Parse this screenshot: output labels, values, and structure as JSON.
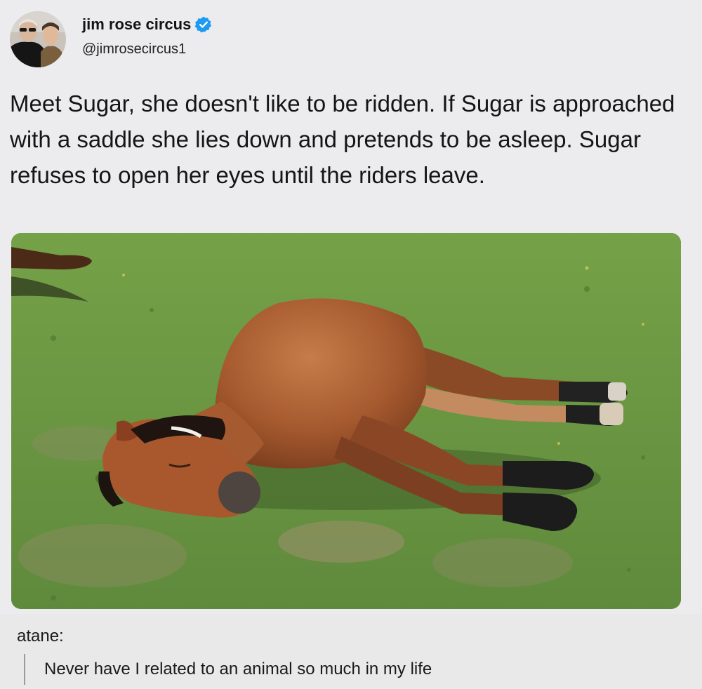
{
  "tweet": {
    "author_name": "jim rose circus",
    "author_handle": "@jimrosecircus1",
    "verified": true,
    "verified_color": "#1d9bf0",
    "text": "Meet Sugar, she doesn't like to be ridden. If Sugar is approached with a saddle she lies down and pretends to be asleep. Sugar refuses to open her eyes until the riders leave.",
    "avatar_icon": "profile-photo-two-men",
    "image_icon": "horse-lying-on-grass-photo"
  },
  "reply": {
    "username": "atane:",
    "text": "Never have I related to an animal so much in my life"
  }
}
